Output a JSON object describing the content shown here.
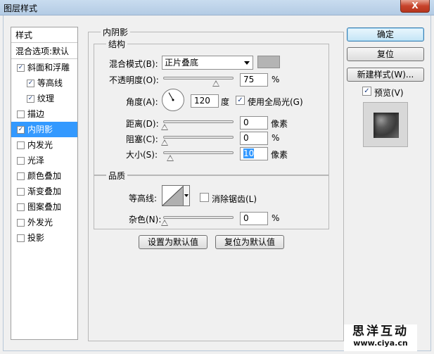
{
  "window": {
    "title": "图层样式",
    "close_label": "X"
  },
  "sidebar": {
    "header": "样式",
    "blend_options": "混合选项:默认",
    "items": [
      {
        "label": "斜面和浮雕",
        "checked": true,
        "indent": false,
        "selected": false
      },
      {
        "label": "等高线",
        "checked": true,
        "indent": true,
        "selected": false
      },
      {
        "label": "纹理",
        "checked": true,
        "indent": true,
        "selected": false
      },
      {
        "label": "描边",
        "checked": false,
        "indent": false,
        "selected": false
      },
      {
        "label": "内阴影",
        "checked": true,
        "indent": false,
        "selected": true
      },
      {
        "label": "内发光",
        "checked": false,
        "indent": false,
        "selected": false
      },
      {
        "label": "光泽",
        "checked": false,
        "indent": false,
        "selected": false
      },
      {
        "label": "颜色叠加",
        "checked": false,
        "indent": false,
        "selected": false
      },
      {
        "label": "渐变叠加",
        "checked": false,
        "indent": false,
        "selected": false
      },
      {
        "label": "图案叠加",
        "checked": false,
        "indent": false,
        "selected": false
      },
      {
        "label": "外发光",
        "checked": false,
        "indent": false,
        "selected": false
      },
      {
        "label": "投影",
        "checked": false,
        "indent": false,
        "selected": false
      }
    ]
  },
  "panel": {
    "title": "内阴影",
    "structure": {
      "title": "结构",
      "blend_mode_label": "混合模式(B):",
      "blend_mode_value": "正片叠底",
      "shadow_color": "#b4b4b4",
      "opacity_label": "不透明度(O):",
      "opacity_value": "75",
      "opacity_unit": "%",
      "opacity_fraction": 0.75,
      "angle_label": "角度(A):",
      "angle_value": "120",
      "angle_unit": "度",
      "use_global_light_label": "使用全局光(G)",
      "use_global_light_checked": true,
      "distance_label": "距离(D):",
      "distance_value": "0",
      "distance_unit": "像素",
      "choke_label": "阻塞(C):",
      "choke_value": "0",
      "choke_unit": "%",
      "size_label": "大小(S):",
      "size_value": "10",
      "size_unit": "像素"
    },
    "quality": {
      "title": "品质",
      "contour_label": "等高线:",
      "antialias_label": "消除锯齿(L)",
      "antialias_checked": false,
      "noise_label": "杂色(N):",
      "noise_value": "0",
      "noise_unit": "%"
    },
    "make_default_label": "设置为默认值",
    "reset_default_label": "复位为默认值"
  },
  "buttons": {
    "ok": "确定",
    "reset": "复位",
    "new_style": "新建样式(W)...",
    "preview_label": "预览(V)",
    "preview_checked": true
  },
  "watermark": {
    "line1": "思洋互动",
    "line2": "www.ciya.cn"
  },
  "colors": {
    "selection": "#3399ff",
    "check": "#1a3d82"
  }
}
